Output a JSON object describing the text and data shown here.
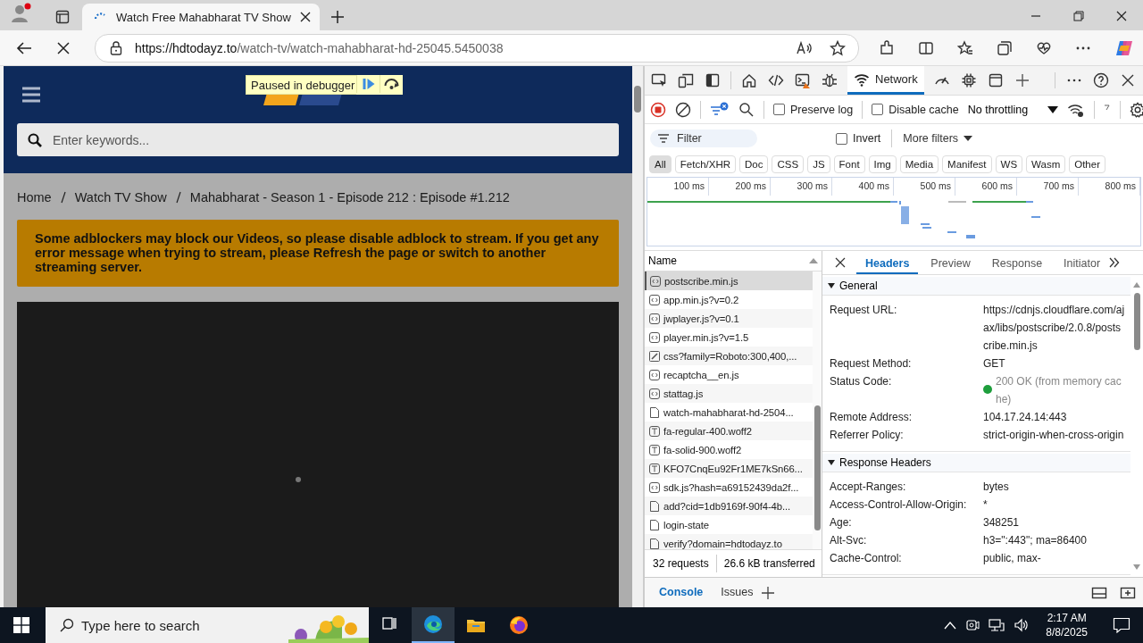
{
  "browser": {
    "tab_title": "Watch Free Mahabharat TV Show",
    "url_host": "https://hdtodayz.to",
    "url_path": "/watch-tv/watch-mahabharat-hd-25045.5450038"
  },
  "page": {
    "search": {
      "placeholder": "Enter keywords..."
    },
    "debugger_banner": "Paused in debugger",
    "breadcrumbs": [
      "Home",
      "Watch TV Show",
      "Mahabharat - Season 1 - Episode 212 : Episode #1.212"
    ],
    "notice": "Some adblockers may block our Videos, so please disable adblock to stream. If you get any error message when trying to stream, please Refresh the page or switch to another streaming server."
  },
  "devtools": {
    "tools": [
      {
        "kind": "inspect",
        "selected": false
      },
      {
        "kind": "device",
        "selected": false
      },
      {
        "kind": "dock",
        "selected": false
      },
      {
        "kind": "welcome",
        "selected": false
      },
      {
        "kind": "elements",
        "selected": false
      },
      {
        "kind": "console",
        "selected": false
      },
      {
        "kind": "sources",
        "selected": false
      },
      {
        "kind": "network",
        "label": "Network",
        "selected": true
      },
      {
        "kind": "performance",
        "selected": false
      },
      {
        "kind": "memory",
        "selected": false
      },
      {
        "kind": "application",
        "selected": false
      },
      {
        "kind": "more_tools",
        "selected": false
      }
    ],
    "network_toolbar": {
      "recording": true,
      "preserve_log": {
        "label": "Preserve log",
        "checked": false
      },
      "disable_cache": {
        "label": "Disable cache",
        "checked": false
      },
      "throttling": "No throttling"
    },
    "filter": {
      "placeholder": "Filter",
      "invert": {
        "label": "Invert",
        "checked": false
      },
      "more_filters": "More filters"
    },
    "type_filters": [
      {
        "label": "All",
        "selected": true
      },
      {
        "label": "Fetch/XHR",
        "selected": false
      },
      {
        "label": "Doc",
        "selected": false
      },
      {
        "label": "CSS",
        "selected": false
      },
      {
        "label": "JS",
        "selected": false
      },
      {
        "label": "Font",
        "selected": false
      },
      {
        "label": "Img",
        "selected": false
      },
      {
        "label": "Media",
        "selected": false
      },
      {
        "label": "Manifest",
        "selected": false
      },
      {
        "label": "WS",
        "selected": false
      },
      {
        "label": "Wasm",
        "selected": false
      },
      {
        "label": "Other",
        "selected": false
      }
    ],
    "timeline_ticks": [
      "100 ms",
      "200 ms",
      "300 ms",
      "400 ms",
      "500 ms",
      "600 ms",
      "700 ms",
      "800 ms"
    ],
    "requests": {
      "column": "Name",
      "rows": [
        {
          "name": "postscribe.min.js",
          "kind": "script",
          "selected": true
        },
        {
          "name": "app.min.js?v=0.2",
          "kind": "script",
          "selected": false
        },
        {
          "name": "jwplayer.js?v=0.1",
          "kind": "script",
          "selected": false
        },
        {
          "name": "player.min.js?v=1.5",
          "kind": "script",
          "selected": false
        },
        {
          "name": "css?family=Roboto:300,400,...",
          "kind": "stylesheet",
          "selected": false
        },
        {
          "name": "recaptcha__en.js",
          "kind": "script",
          "selected": false
        },
        {
          "name": "stattag.js",
          "kind": "script",
          "selected": false
        },
        {
          "name": "watch-mahabharat-hd-2504...",
          "kind": "document",
          "selected": false
        },
        {
          "name": "fa-regular-400.woff2",
          "kind": "font",
          "selected": false
        },
        {
          "name": "fa-solid-900.woff2",
          "kind": "font",
          "selected": false
        },
        {
          "name": "KFO7CnqEu92Fr1ME7kSn66...",
          "kind": "font",
          "selected": false
        },
        {
          "name": "sdk.js?hash=a69152439da2f...",
          "kind": "script",
          "selected": false
        },
        {
          "name": "add?cid=1db9169f-90f4-4b...",
          "kind": "document",
          "selected": false
        },
        {
          "name": "login-state",
          "kind": "document",
          "selected": false
        },
        {
          "name": "verify?domain=hdtodayz.to",
          "kind": "document",
          "selected": false
        }
      ],
      "summary": [
        "32 requests",
        "26.6 kB transferred"
      ]
    },
    "detail_tabs": [
      {
        "label": "Headers",
        "selected": true
      },
      {
        "label": "Preview",
        "selected": false
      },
      {
        "label": "Response",
        "selected": false
      },
      {
        "label": "Initiator",
        "selected": false
      }
    ],
    "sections": [
      {
        "title": "General",
        "expanded": true,
        "rows": [
          {
            "name": "Request URL:",
            "value": "https://cdnjs.cloudflare.com/ajax/libs/postscribe/2.0.8/postscribe.min.js"
          },
          {
            "name": "Request Method:",
            "value": "GET"
          },
          {
            "name": "Status Code:",
            "value": "200 OK (from memory cache)",
            "color": "#1e9e3c"
          },
          {
            "name": "Remote Address:",
            "value": "104.17.24.14:443"
          },
          {
            "name": "Referrer Policy:",
            "value": "strict-origin-when-cross-origin"
          }
        ]
      },
      {
        "title": "Response Headers",
        "expanded": true,
        "rows": [
          {
            "name": "Accept-Ranges:",
            "value": "bytes"
          },
          {
            "name": "Access-Control-Allow-Origin:",
            "value": "*"
          },
          {
            "name": "Age:",
            "value": "348251"
          },
          {
            "name": "Alt-Svc:",
            "value": "h3=\":443\"; ma=86400"
          },
          {
            "name": "Cache-Control:",
            "value": "public, max-"
          }
        ]
      }
    ],
    "drawer_tabs": [
      {
        "label": "Console",
        "selected": true
      },
      {
        "label": "Issues",
        "selected": false
      }
    ]
  },
  "taskbar": {
    "search_placeholder": "Type here to search",
    "apps": [
      {
        "kind": "task_view",
        "active": false
      },
      {
        "kind": "edge",
        "active": true
      },
      {
        "kind": "files",
        "active": false
      },
      {
        "kind": "firefox",
        "active": false
      }
    ],
    "time": "2:17 AM",
    "date": "8/8/2025"
  }
}
